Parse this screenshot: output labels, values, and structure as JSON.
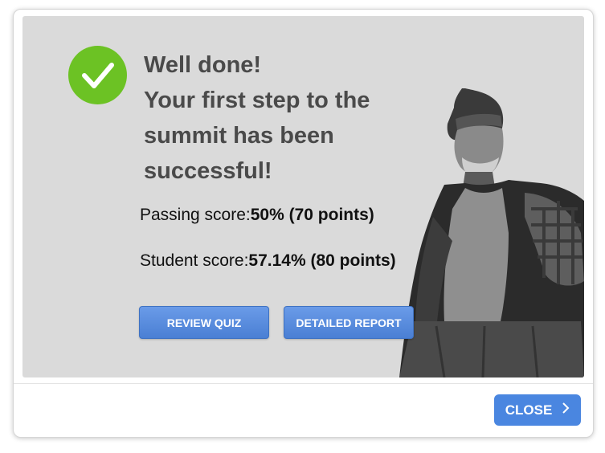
{
  "result": {
    "headline_lines": [
      "Well done!",
      "Your first step to the",
      "summit has been",
      "successful!"
    ],
    "passing": {
      "label": "Passing score:",
      "value": "50% (70 points)"
    },
    "student": {
      "label": "Student score:",
      "value": "57.14% (80 points)"
    }
  },
  "actions": {
    "review_label": "REVIEW QUIZ",
    "report_label": "DETAILED REPORT"
  },
  "footer": {
    "close_label": "CLOSE"
  },
  "icons": {
    "success": "checkmark-icon",
    "close_chevron": "chevron-right-icon"
  },
  "colors": {
    "success_green": "#6cc224",
    "button_blue": "#4a86e0",
    "panel_gray": "#dadada",
    "headline_text": "#4a4a4a"
  }
}
